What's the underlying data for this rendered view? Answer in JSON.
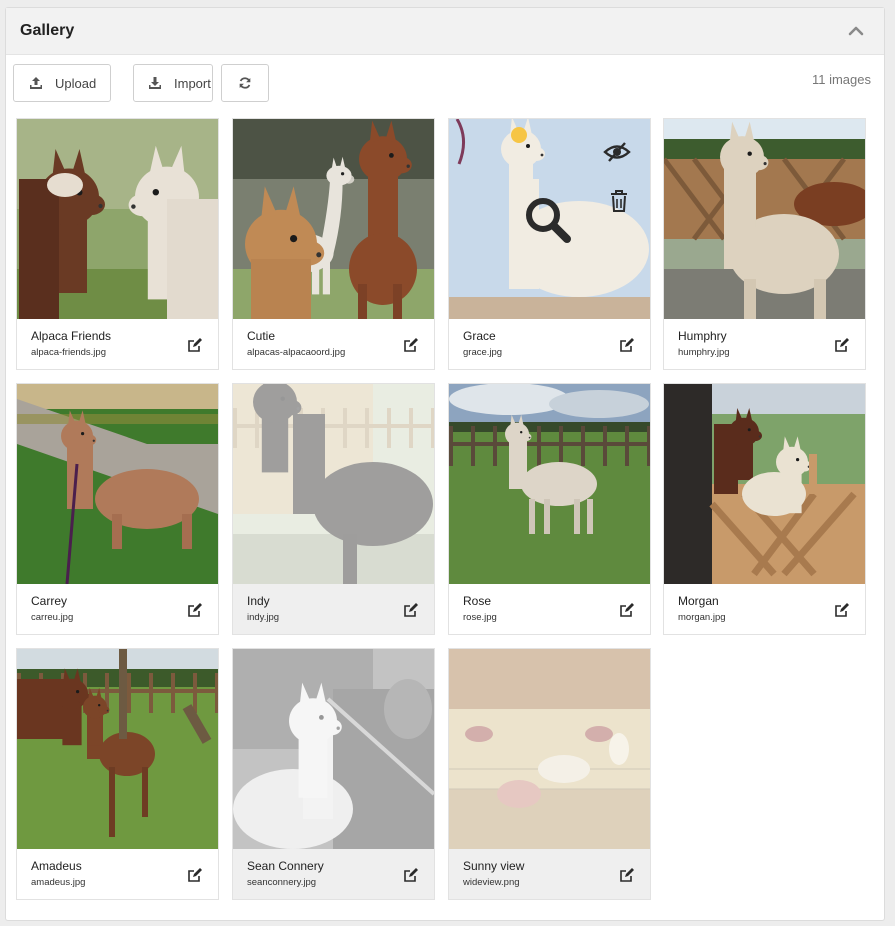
{
  "panel": {
    "title": "Gallery"
  },
  "toolbar": {
    "upload_label": "Upload",
    "import_label": "Import",
    "count": "11 images"
  },
  "items": [
    {
      "caption": "Alpaca Friends",
      "file": "alpaca-friends.jpg",
      "hidden": false,
      "scene": "friends"
    },
    {
      "caption": "Cutie",
      "file": "alpacas-alpacaoord.jpg",
      "hidden": false,
      "scene": "cutie"
    },
    {
      "caption": "Grace",
      "file": "grace.jpg",
      "hidden": false,
      "scene": "grace"
    },
    {
      "caption": "Humphry",
      "file": "humphry.jpg",
      "hidden": false,
      "scene": "humphry"
    },
    {
      "caption": "Carrey",
      "file": "carreu.jpg",
      "hidden": false,
      "scene": "carrey"
    },
    {
      "caption": "Indy",
      "file": "indy.jpg",
      "hidden": true,
      "scene": "indy"
    },
    {
      "caption": "Rose",
      "file": "rose.jpg",
      "hidden": false,
      "scene": "rose"
    },
    {
      "caption": "Morgan",
      "file": "morgan.jpg",
      "hidden": false,
      "scene": "morgan"
    },
    {
      "caption": "Amadeus",
      "file": "amadeus.jpg",
      "hidden": false,
      "scene": "amadeus"
    },
    {
      "caption": "Sean Connery",
      "file": "seanconnery.jpg",
      "hidden": true,
      "scene": "sean"
    },
    {
      "caption": "Sunny view",
      "file": "wideview.png",
      "hidden": true,
      "scene": "sunny"
    }
  ],
  "hovered_item": 2,
  "icons": {
    "collapse": "chevron-up-icon",
    "upload": "upload-icon",
    "import": "download-icon",
    "refresh": "refresh-icon",
    "edit": "edit-icon",
    "visibility": "eye-slash-icon",
    "delete": "trash-icon",
    "zoom": "search-icon"
  }
}
